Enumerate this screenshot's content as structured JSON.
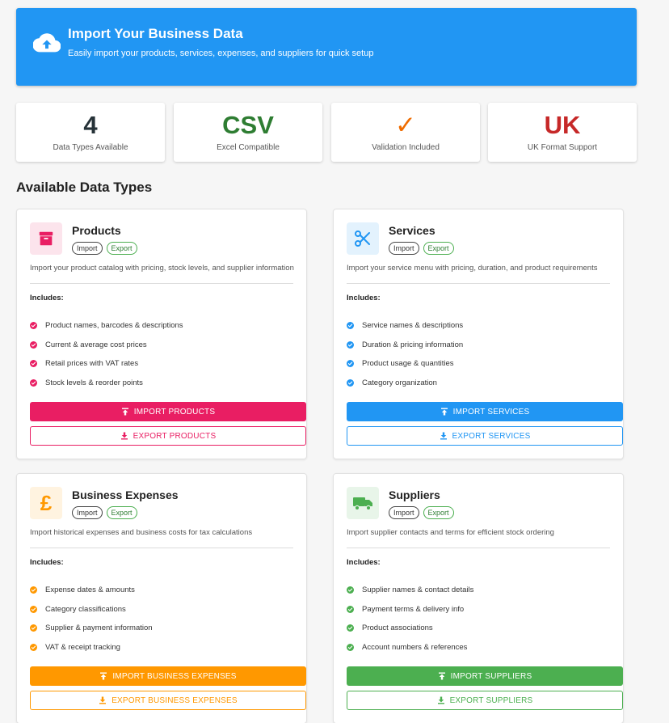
{
  "header": {
    "title": "Import Your Business Data",
    "subtitle": "Easily import your products, services, expenses, and suppliers for quick setup"
  },
  "stats": [
    {
      "value": "4",
      "label": "Data Types Available",
      "color": "#263238"
    },
    {
      "value": "CSV",
      "label": "Excel Compatible",
      "color": "#2e7d32"
    },
    {
      "value": "✓",
      "label": "Validation Included",
      "color": "#ef6c00"
    },
    {
      "value": "UK",
      "label": "UK Format Support",
      "color": "#c62828"
    }
  ],
  "section_title": "Available Data Types",
  "chips": {
    "import": "Import",
    "export": "Export"
  },
  "includes_label": "Includes:",
  "cards": [
    {
      "title": "Products",
      "description": "Import your product catalog with pricing, stock levels, and supplier information",
      "features": [
        "Product names, barcodes & descriptions",
        "Current & average cost prices",
        "Retail prices with VAT rates",
        "Stock levels & reorder points"
      ],
      "import_label": "IMPORT PRODUCTS",
      "export_label": "EXPORT PRODUCTS",
      "color": "#e91e63",
      "icon_bg": "#fce4ec",
      "icon": "archive-box-icon"
    },
    {
      "title": "Services",
      "description": "Import your service menu with pricing, duration, and product requirements",
      "features": [
        "Service names & descriptions",
        "Duration & pricing information",
        "Product usage & quantities",
        "Category organization"
      ],
      "import_label": "IMPORT SERVICES",
      "export_label": "EXPORT SERVICES",
      "color": "#2196f3",
      "icon_bg": "#e3f2fd",
      "icon": "scissors-icon"
    },
    {
      "title": "Business Expenses",
      "description": "Import historical expenses and business costs for tax calculations",
      "features": [
        "Expense dates & amounts",
        "Category classifications",
        "Supplier & payment information",
        "VAT & receipt tracking"
      ],
      "import_label": "IMPORT BUSINESS EXPENSES",
      "export_label": "EXPORT BUSINESS EXPENSES",
      "color": "#ff9800",
      "icon_bg": "#fff3e0",
      "icon": "pound-icon",
      "icon_glyph": "£"
    },
    {
      "title": "Suppliers",
      "description": "Import supplier contacts and terms for efficient stock ordering",
      "features": [
        "Supplier names & contact details",
        "Payment terms & delivery info",
        "Product associations",
        "Account numbers & references"
      ],
      "import_label": "IMPORT SUPPLIERS",
      "export_label": "EXPORT SUPPLIERS",
      "color": "#4caf50",
      "icon_bg": "#e8f5e9",
      "icon": "truck-icon"
    }
  ]
}
